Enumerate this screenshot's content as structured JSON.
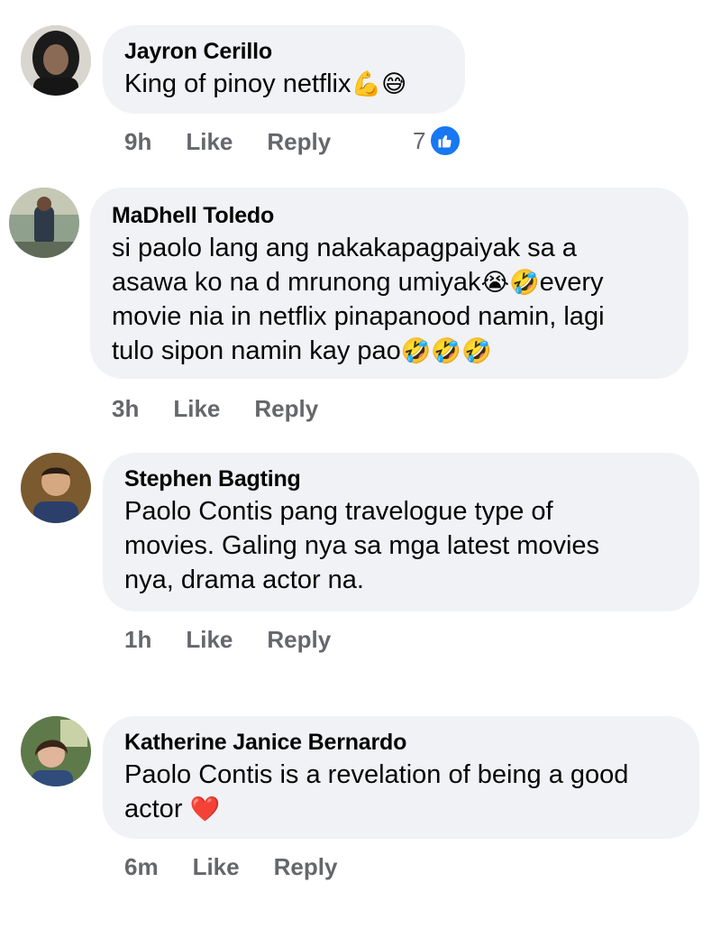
{
  "comments": [
    {
      "author": "Jayron Cerillo",
      "text": "King of pinoy netflix",
      "emoji": "💪😅",
      "time": "9h",
      "like_label": "Like",
      "reply_label": "Reply",
      "reaction_count": "7"
    },
    {
      "author": "MaDhell Toledo",
      "line1": "si paolo lang ang nakakapagpaiyak sa a",
      "line2": "asawa ko na d mrunong umiyak",
      "emoji2": "😭🤣",
      "line2b": "every",
      "line3": "movie nia in netflix pinapanood namin, lagi",
      "line4": "tulo sipon namin kay pao",
      "emoji4": "🤣🤣🤣",
      "time": "3h",
      "like_label": "Like",
      "reply_label": "Reply"
    },
    {
      "author": "Stephen Bagting",
      "line1": "Paolo Contis pang travelogue type of",
      "line2": "movies. Galing nya sa mga latest movies",
      "line3": "nya, drama actor na.",
      "time": "1h",
      "like_label": "Like",
      "reply_label": "Reply"
    },
    {
      "author": "Katherine Janice Bernardo",
      "line1": "Paolo Contis is a revelation of being a good",
      "line2": "actor",
      "emoji2": "❤️",
      "time": "6m",
      "like_label": "Like",
      "reply_label": "Reply"
    }
  ],
  "colors": {
    "bubble": "#f0f2f5",
    "meta": "#65676b",
    "like_blue": "#1877f2"
  }
}
